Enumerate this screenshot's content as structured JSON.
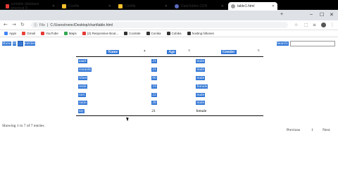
{
  "tabs": [
    {
      "label": "sortable database practical D...",
      "color": "#e53935"
    },
    {
      "label": "Confile",
      "color": "#fbc02d"
    },
    {
      "label": "Confile",
      "color": "#fbc02d"
    },
    {
      "label": "DataTables CDN",
      "color": "#5c6bc0"
    },
    {
      "label": "table1.html",
      "color": "#9e9e9e"
    }
  ],
  "toolbar": {
    "url_prefix": "File",
    "url": "C:/Users/ronnc/Desktop/chart/table.html"
  },
  "bookmarks": [
    {
      "label": "Apps",
      "color": "#4285f4"
    },
    {
      "label": "Gmail",
      "color": "#ea4335"
    },
    {
      "label": "YouTube",
      "color": "#e53935"
    },
    {
      "label": "Maps",
      "color": "#34a853"
    },
    {
      "label": "(2) Responsive Boot...",
      "color": "#e53935"
    },
    {
      "label": "Coolsite",
      "color": "#333333"
    },
    {
      "label": "Conika",
      "color": "#333333"
    },
    {
      "label": "Cobika",
      "color": "#333333"
    },
    {
      "label": "hosting hiltones",
      "color": "#333333"
    }
  ],
  "page": {
    "show_label": "Show",
    "length_value": "10",
    "entries_label": "entries",
    "search_label": "Search:",
    "search_value": "",
    "columns": [
      "Name",
      "Age",
      "Gender"
    ],
    "rows": [
      [
        "aaarl",
        "21",
        "male"
      ],
      [
        "roounik",
        "21",
        "male"
      ],
      [
        "lilhet",
        "60",
        "male"
      ],
      [
        "reshi",
        "19",
        "female"
      ],
      [
        "ravi",
        "22",
        "male"
      ],
      [
        "rasin",
        "28",
        "male"
      ],
      [
        "tay",
        "21",
        "female"
      ]
    ],
    "info": "Showing 1 to 7 of 7 entries",
    "prev_label": "Previous",
    "page_number": "1",
    "next_label": "Next"
  }
}
